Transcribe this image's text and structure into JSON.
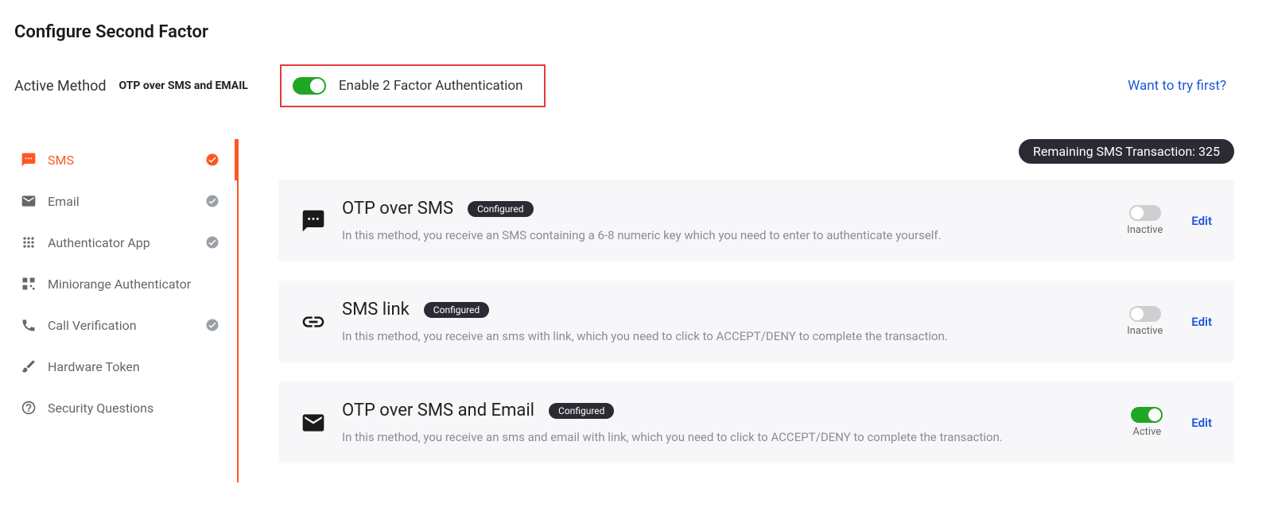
{
  "page_title": "Configure Second Factor",
  "active_method": {
    "label": "Active Method",
    "value": "OTP over SMS and EMAIL"
  },
  "enable_2fa": {
    "label": "Enable 2 Factor Authentication",
    "enabled": true
  },
  "try_link": "Want to try first?",
  "remaining_sms_badge": "Remaining SMS Transaction: 325",
  "sidebar": {
    "items": [
      {
        "label": "SMS",
        "checked": true,
        "active": true,
        "icon": "sms"
      },
      {
        "label": "Email",
        "checked": true,
        "active": false,
        "icon": "email"
      },
      {
        "label": "Authenticator App",
        "checked": true,
        "active": false,
        "icon": "apps"
      },
      {
        "label": "Miniorange Authenticator",
        "checked": false,
        "active": false,
        "icon": "qr"
      },
      {
        "label": "Call Verification",
        "checked": true,
        "active": false,
        "icon": "call"
      },
      {
        "label": "Hardware Token",
        "checked": false,
        "active": false,
        "icon": "hardware"
      },
      {
        "label": "Security Questions",
        "checked": false,
        "active": false,
        "icon": "question"
      }
    ]
  },
  "cards": [
    {
      "icon": "sms",
      "title": "OTP over SMS",
      "badge": "Configured",
      "desc": "In this method, you receive an SMS containing a 6-8 numeric key which you need to enter to authenticate yourself.",
      "active": false,
      "status": "Inactive",
      "edit": "Edit"
    },
    {
      "icon": "link",
      "title": "SMS link",
      "badge": "Configured",
      "desc": "In this method, you receive an sms with link, which you need to click to ACCEPT/DENY to complete the transaction.",
      "active": false,
      "status": "Inactive",
      "edit": "Edit"
    },
    {
      "icon": "email",
      "title": "OTP over SMS and Email",
      "badge": "Configured",
      "desc": "In this method, you receive an sms and email with link, which you need to click to ACCEPT/DENY to complete the transaction.",
      "active": true,
      "status": "Active",
      "edit": "Edit"
    }
  ]
}
